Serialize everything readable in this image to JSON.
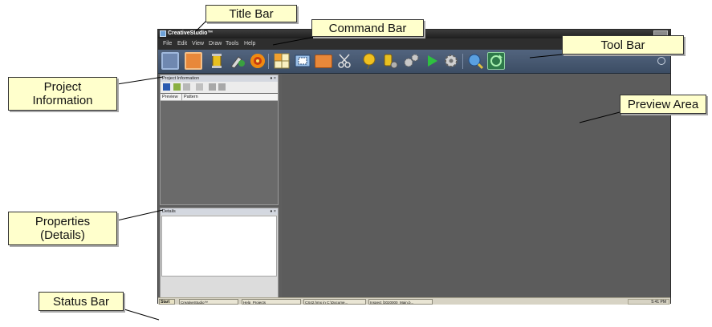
{
  "app": {
    "title": "CreativeStudio™",
    "menu": [
      "File",
      "Edit",
      "View",
      "Draw",
      "Tools",
      "Help"
    ],
    "toolbar_icons": [
      "select-rectangle-icon",
      "fill-rectangle-icon",
      "thread-spool-icon",
      "draw-tool-icon",
      "target-circle-icon",
      "color-grid-icon",
      "frame-icon",
      "orange-block-icon",
      "scissors-icon",
      "balloon-icon",
      "thread-tools-icon",
      "gear-group-icon",
      "play-icon",
      "settings-gear-icon",
      "globe-search-icon",
      "refresh-icon"
    ],
    "project_panel": {
      "title": "Project Information",
      "controls": "♦ ×",
      "columns": [
        "Preview",
        "Pattern"
      ]
    },
    "details_panel": {
      "title": "Details",
      "controls": "♦ ×"
    },
    "taskbar": {
      "start": "Start",
      "tasks": [
        "CreativeStudio™",
        "Help_Projects",
        "CS42.hmx in C:\\Docume...",
        "Inspect [3020000_Main.b..."
      ],
      "clock": "5:41 PM"
    }
  },
  "callouts": {
    "title_bar": "Title Bar",
    "command_bar": "Command Bar",
    "tool_bar": "Tool Bar",
    "project_information": "Project\nInformation",
    "preview_area": "Preview Area",
    "properties": "Properties\n(Details)",
    "status_bar": "Status Bar"
  }
}
